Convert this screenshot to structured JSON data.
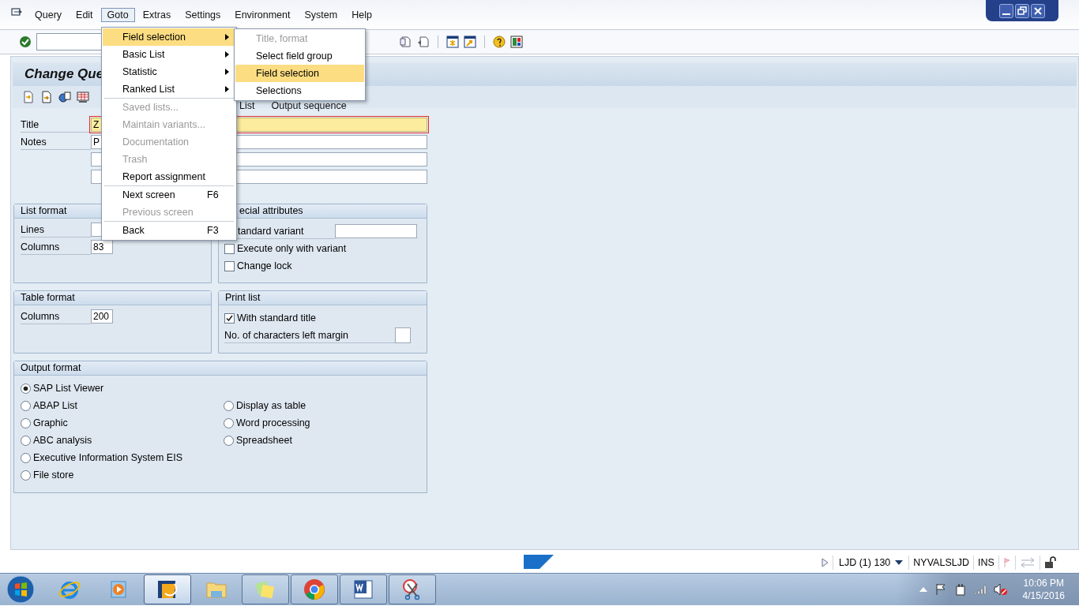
{
  "menu_bar": [
    {
      "label": "Query",
      "selected": false
    },
    {
      "label": "Edit",
      "selected": false
    },
    {
      "label": "Goto",
      "selected": true
    },
    {
      "label": "Extras",
      "selected": false
    },
    {
      "label": "Settings",
      "selected": false
    },
    {
      "label": "Environment",
      "selected": false
    },
    {
      "label": "System",
      "selected": false
    },
    {
      "label": "Help",
      "selected": false
    }
  ],
  "goto_menu": [
    {
      "kind": "submenu",
      "label": "Field selection",
      "disabled": false,
      "selected": true
    },
    {
      "kind": "submenu",
      "label": "Basic List",
      "disabled": false,
      "selected": false
    },
    {
      "kind": "submenu",
      "label": "Statistic",
      "disabled": false,
      "selected": false
    },
    {
      "kind": "submenu",
      "label": "Ranked List",
      "disabled": false,
      "selected": false
    },
    {
      "kind": "separator"
    },
    {
      "kind": "item",
      "label": "Saved lists...",
      "disabled": true,
      "selected": false
    },
    {
      "kind": "item",
      "label": "Maintain variants...",
      "disabled": true,
      "selected": false
    },
    {
      "kind": "item",
      "label": "Documentation",
      "disabled": true,
      "selected": false
    },
    {
      "kind": "item",
      "label": "Trash",
      "disabled": true,
      "selected": false
    },
    {
      "kind": "item",
      "label": "Report assignment",
      "disabled": false,
      "selected": false
    },
    {
      "kind": "separator"
    },
    {
      "kind": "item",
      "label": "Next screen",
      "shortcut": "F6",
      "disabled": false,
      "selected": false
    },
    {
      "kind": "item",
      "label": "Previous screen",
      "disabled": true,
      "selected": false
    },
    {
      "kind": "separator"
    },
    {
      "kind": "item",
      "label": "Back",
      "shortcut": "F3",
      "disabled": false,
      "selected": false
    }
  ],
  "field_selection_submenu": [
    {
      "label": "Title, format",
      "disabled": true,
      "selected": false
    },
    {
      "label": "Select field group",
      "disabled": false,
      "selected": false
    },
    {
      "label": "Field selection",
      "disabled": false,
      "selected": true
    },
    {
      "label": "Selections",
      "disabled": false,
      "selected": false
    }
  ],
  "screen_title": "Change Que",
  "app_toolbar": [
    "List",
    "Output sequence"
  ],
  "header_fields": [
    {
      "label": "Title",
      "value": "Z",
      "focused": true
    },
    {
      "label": "Notes",
      "value": "P",
      "focused": false
    },
    {
      "focused": false
    },
    {
      "focused": false
    }
  ],
  "list_format": {
    "header": "List format",
    "fields": [
      {
        "label": "Lines"
      },
      {
        "label": "Columns",
        "value": "83"
      }
    ]
  },
  "special_attributes": {
    "header": "ecial attributes",
    "standard_variant_label": "tandard variant",
    "options": [
      {
        "label": "Execute only with variant",
        "checked": false
      },
      {
        "label": "Change lock",
        "checked": false
      }
    ]
  },
  "table_format": {
    "header": "Table format",
    "fields": [
      {
        "label": "Columns",
        "value": "200"
      }
    ]
  },
  "print_list": {
    "header": "Print list",
    "options": [
      {
        "label": "With standard title",
        "checked": true
      }
    ],
    "margin_label": "No. of characters left margin"
  },
  "output_format": {
    "header": "Output format",
    "left": [
      {
        "label": "SAP List Viewer",
        "selected": true
      },
      {
        "label": "ABAP List",
        "selected": false
      },
      {
        "label": "Graphic",
        "selected": false
      },
      {
        "label": "ABC analysis",
        "selected": false
      },
      {
        "label": "Executive Information System EIS",
        "selected": false
      },
      {
        "label": "File store",
        "selected": false
      }
    ],
    "right": [
      {
        "label": "Display as table",
        "selected": false
      },
      {
        "label": "Word processing",
        "selected": false
      },
      {
        "label": "Spreadsheet",
        "selected": false
      }
    ]
  },
  "status_bar": {
    "system": "LJD (1) 130",
    "user": "NYVALSLJD",
    "mode": "INS"
  },
  "taskbar": [
    {
      "kind": "ie",
      "running": false,
      "selected": false
    },
    {
      "kind": "media",
      "running": false,
      "selected": false
    },
    {
      "kind": "sap",
      "running": true,
      "selected": true
    },
    {
      "kind": "explorer",
      "running": false,
      "selected": false
    },
    {
      "kind": "notes",
      "running": true,
      "selected": false
    },
    {
      "kind": "chrome",
      "running": true,
      "selected": false
    },
    {
      "kind": "word",
      "running": true,
      "selected": false
    },
    {
      "kind": "snip",
      "running": true,
      "selected": false
    }
  ],
  "clock": {
    "time": "10:06 PM",
    "date": "4/15/2016"
  }
}
